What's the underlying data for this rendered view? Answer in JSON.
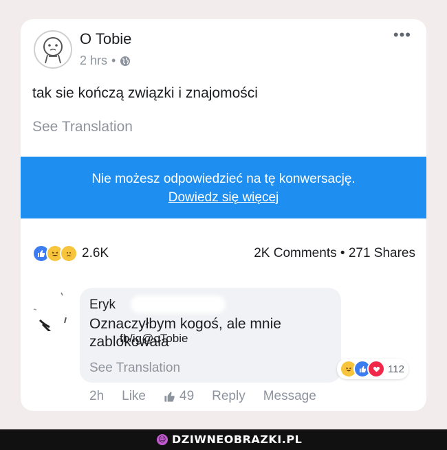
{
  "post": {
    "author": "O Tobie",
    "time": "2 hrs",
    "separator": "•",
    "more_label": "•••",
    "text": "tak sie kończą związki i znajomości",
    "see_translation": "See Translation"
  },
  "banner": {
    "message": "Nie możesz odpowiedzieć na tę konwersację.",
    "link": "Dowiedz się więcej",
    "color": "#1e8ff0"
  },
  "stats": {
    "reactions_count": "2.6K",
    "comments": "2K Comments",
    "dot": "•",
    "shares": "271 Shares"
  },
  "comment": {
    "author": "Eryk",
    "text": "Oznaczyłbym kogoś, ale mnie zablokowała",
    "see_translation": "See Translation",
    "reaction_count": "112",
    "actions": {
      "time": "2h",
      "like": "Like",
      "like_count": "49",
      "reply": "Reply",
      "message": "Message"
    }
  },
  "watermark": "fb/ig@oTobie",
  "footer": {
    "brand": "DZIWNEOBRAZKI.PL"
  },
  "icons": [
    "globe-icon",
    "more-icon",
    "like-reaction-icon",
    "haha-reaction-icon",
    "sad-reaction-icon",
    "love-reaction-icon",
    "thumbs-up-icon",
    "brand-icon"
  ]
}
